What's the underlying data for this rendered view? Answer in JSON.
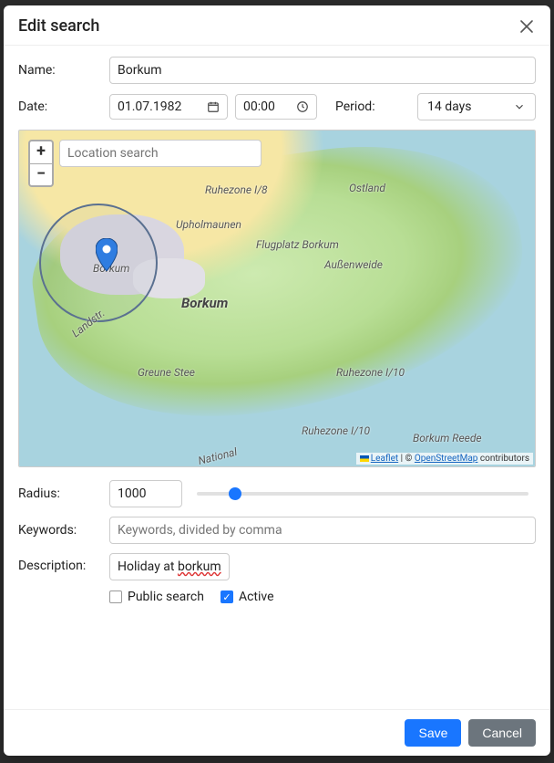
{
  "modal": {
    "title": "Edit search",
    "close_label": "Close"
  },
  "form": {
    "name_label": "Name:",
    "name_value": "Borkum",
    "date_label": "Date:",
    "date_value": "01.07.1982",
    "time_value": "00:00",
    "period_label": "Period:",
    "period_value": "14 days",
    "radius_label": "Radius:",
    "radius_value": "1000",
    "radius_slider_min": 0,
    "radius_slider_max": 10000,
    "keywords_label": "Keywords:",
    "keywords_value": "",
    "keywords_placeholder": "Keywords, divided by comma",
    "description_label": "Description:",
    "description_value_prefix": "Holiday at ",
    "description_value_misspelled": "borkum",
    "public_label": "Public search",
    "public_checked": false,
    "active_label": "Active",
    "active_checked": true
  },
  "map": {
    "location_search_placeholder": "Location search",
    "zoom_in_label": "+",
    "zoom_out_label": "−",
    "labels": {
      "borkum_town": "Borkum",
      "borkum_big": "Borkum",
      "ostland": "Ostland",
      "ruhezone18": "Ruhezone I/8",
      "upholmaunen": "Upholmaunen",
      "flugplatz": "Flugplatz Borkum",
      "aussenweide": "Außenweide",
      "greunestee": "Greune Stee",
      "ruhezone110a": "Ruhezone I/10",
      "ruhezone110b": "Ruhezone I/10",
      "landstr": "Landstr.",
      "national": "National",
      "reede": "Borkum Reede"
    },
    "attribution": {
      "leaflet": "Leaflet",
      "osm": "OpenStreetMap",
      "contrib": " contributors",
      "sep": " | © "
    }
  },
  "footer": {
    "save_label": "Save",
    "cancel_label": "Cancel"
  }
}
